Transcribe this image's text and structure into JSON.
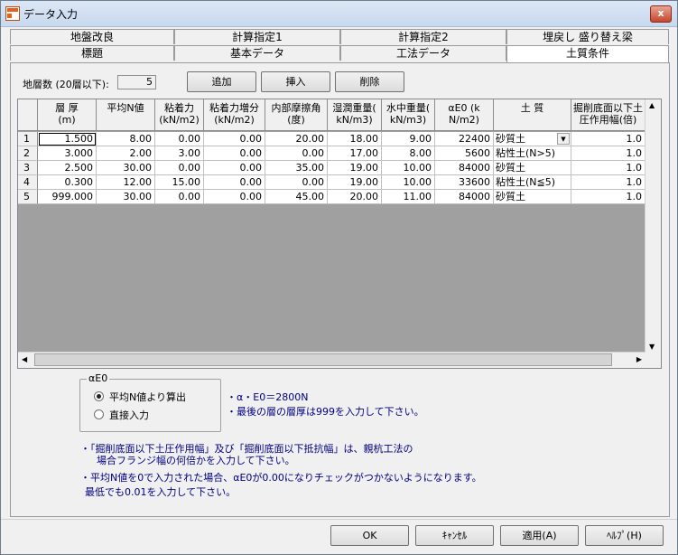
{
  "window": {
    "title": "データ入力",
    "close": "x"
  },
  "tabs": {
    "row1": [
      "地盤改良",
      "計算指定1",
      "計算指定2",
      "埋戻し 盛り替え梁"
    ],
    "row2": [
      "標題",
      "基本データ",
      "工法データ",
      "土質条件"
    ],
    "active": "土質条件"
  },
  "layer_count": {
    "label": "地層数 (20層以下):",
    "value": "5"
  },
  "buttons": {
    "add": "追加",
    "insert": "挿入",
    "delete": "削除",
    "ok": "OK",
    "cancel": "ｷｬﾝｾﾙ",
    "apply": "適用(A)",
    "help": "ﾍﾙﾌﾟ(H)"
  },
  "grid": {
    "headers": [
      "層 厚\n(m)",
      "平均N値",
      "粘着力\n(kN/m2)",
      "粘着力増分\n(kN/m2)",
      "内部摩擦角\n(度)",
      "湿潤重量(\nkN/m3)",
      "水中重量(\nkN/m3)",
      "αE0 (k\nN/m2)",
      "土 質",
      "掘削底面以下土\n圧作用幅(倍)"
    ],
    "rows": [
      {
        "no": "1",
        "values": [
          "1.500",
          "8.00",
          "0.00",
          "0.00",
          "20.00",
          "18.00",
          "9.00",
          "22400",
          "砂質土",
          "1.0"
        ]
      },
      {
        "no": "2",
        "values": [
          "3.000",
          "2.00",
          "3.00",
          "0.00",
          "0.00",
          "17.00",
          "8.00",
          "5600",
          "粘性土(N>5)",
          "1.0"
        ]
      },
      {
        "no": "3",
        "values": [
          "2.500",
          "30.00",
          "0.00",
          "0.00",
          "35.00",
          "19.00",
          "10.00",
          "84000",
          "砂質土",
          "1.0"
        ]
      },
      {
        "no": "4",
        "values": [
          "0.300",
          "12.00",
          "15.00",
          "0.00",
          "0.00",
          "19.00",
          "10.00",
          "33600",
          "粘性土(N≦5)",
          "1.0"
        ]
      },
      {
        "no": "5",
        "values": [
          "999.000",
          "30.00",
          "0.00",
          "0.00",
          "45.00",
          "20.00",
          "11.00",
          "84000",
          "砂質土",
          "1.0"
        ]
      }
    ]
  },
  "alpha_e0": {
    "legend": "αE0",
    "option_avg": "平均N値より算出",
    "option_direct": "直接入力",
    "selected": "avg"
  },
  "notes": {
    "n1": "・α・E0＝2800N",
    "n2": "・最後の層の層厚は999を入力して下さい。",
    "n3": "・「掘削底面以下土圧作用幅」及び「掘削底面以下抵抗幅」は、親杭工法の",
    "n4": "場合フランジ幅の何倍かを入力して下さい。",
    "n5": "・平均N値を0で入力された場合、αE0が0.00になりチェックがつかないようになります。",
    "n6": "最低でも0.01を入力して下さい。"
  }
}
